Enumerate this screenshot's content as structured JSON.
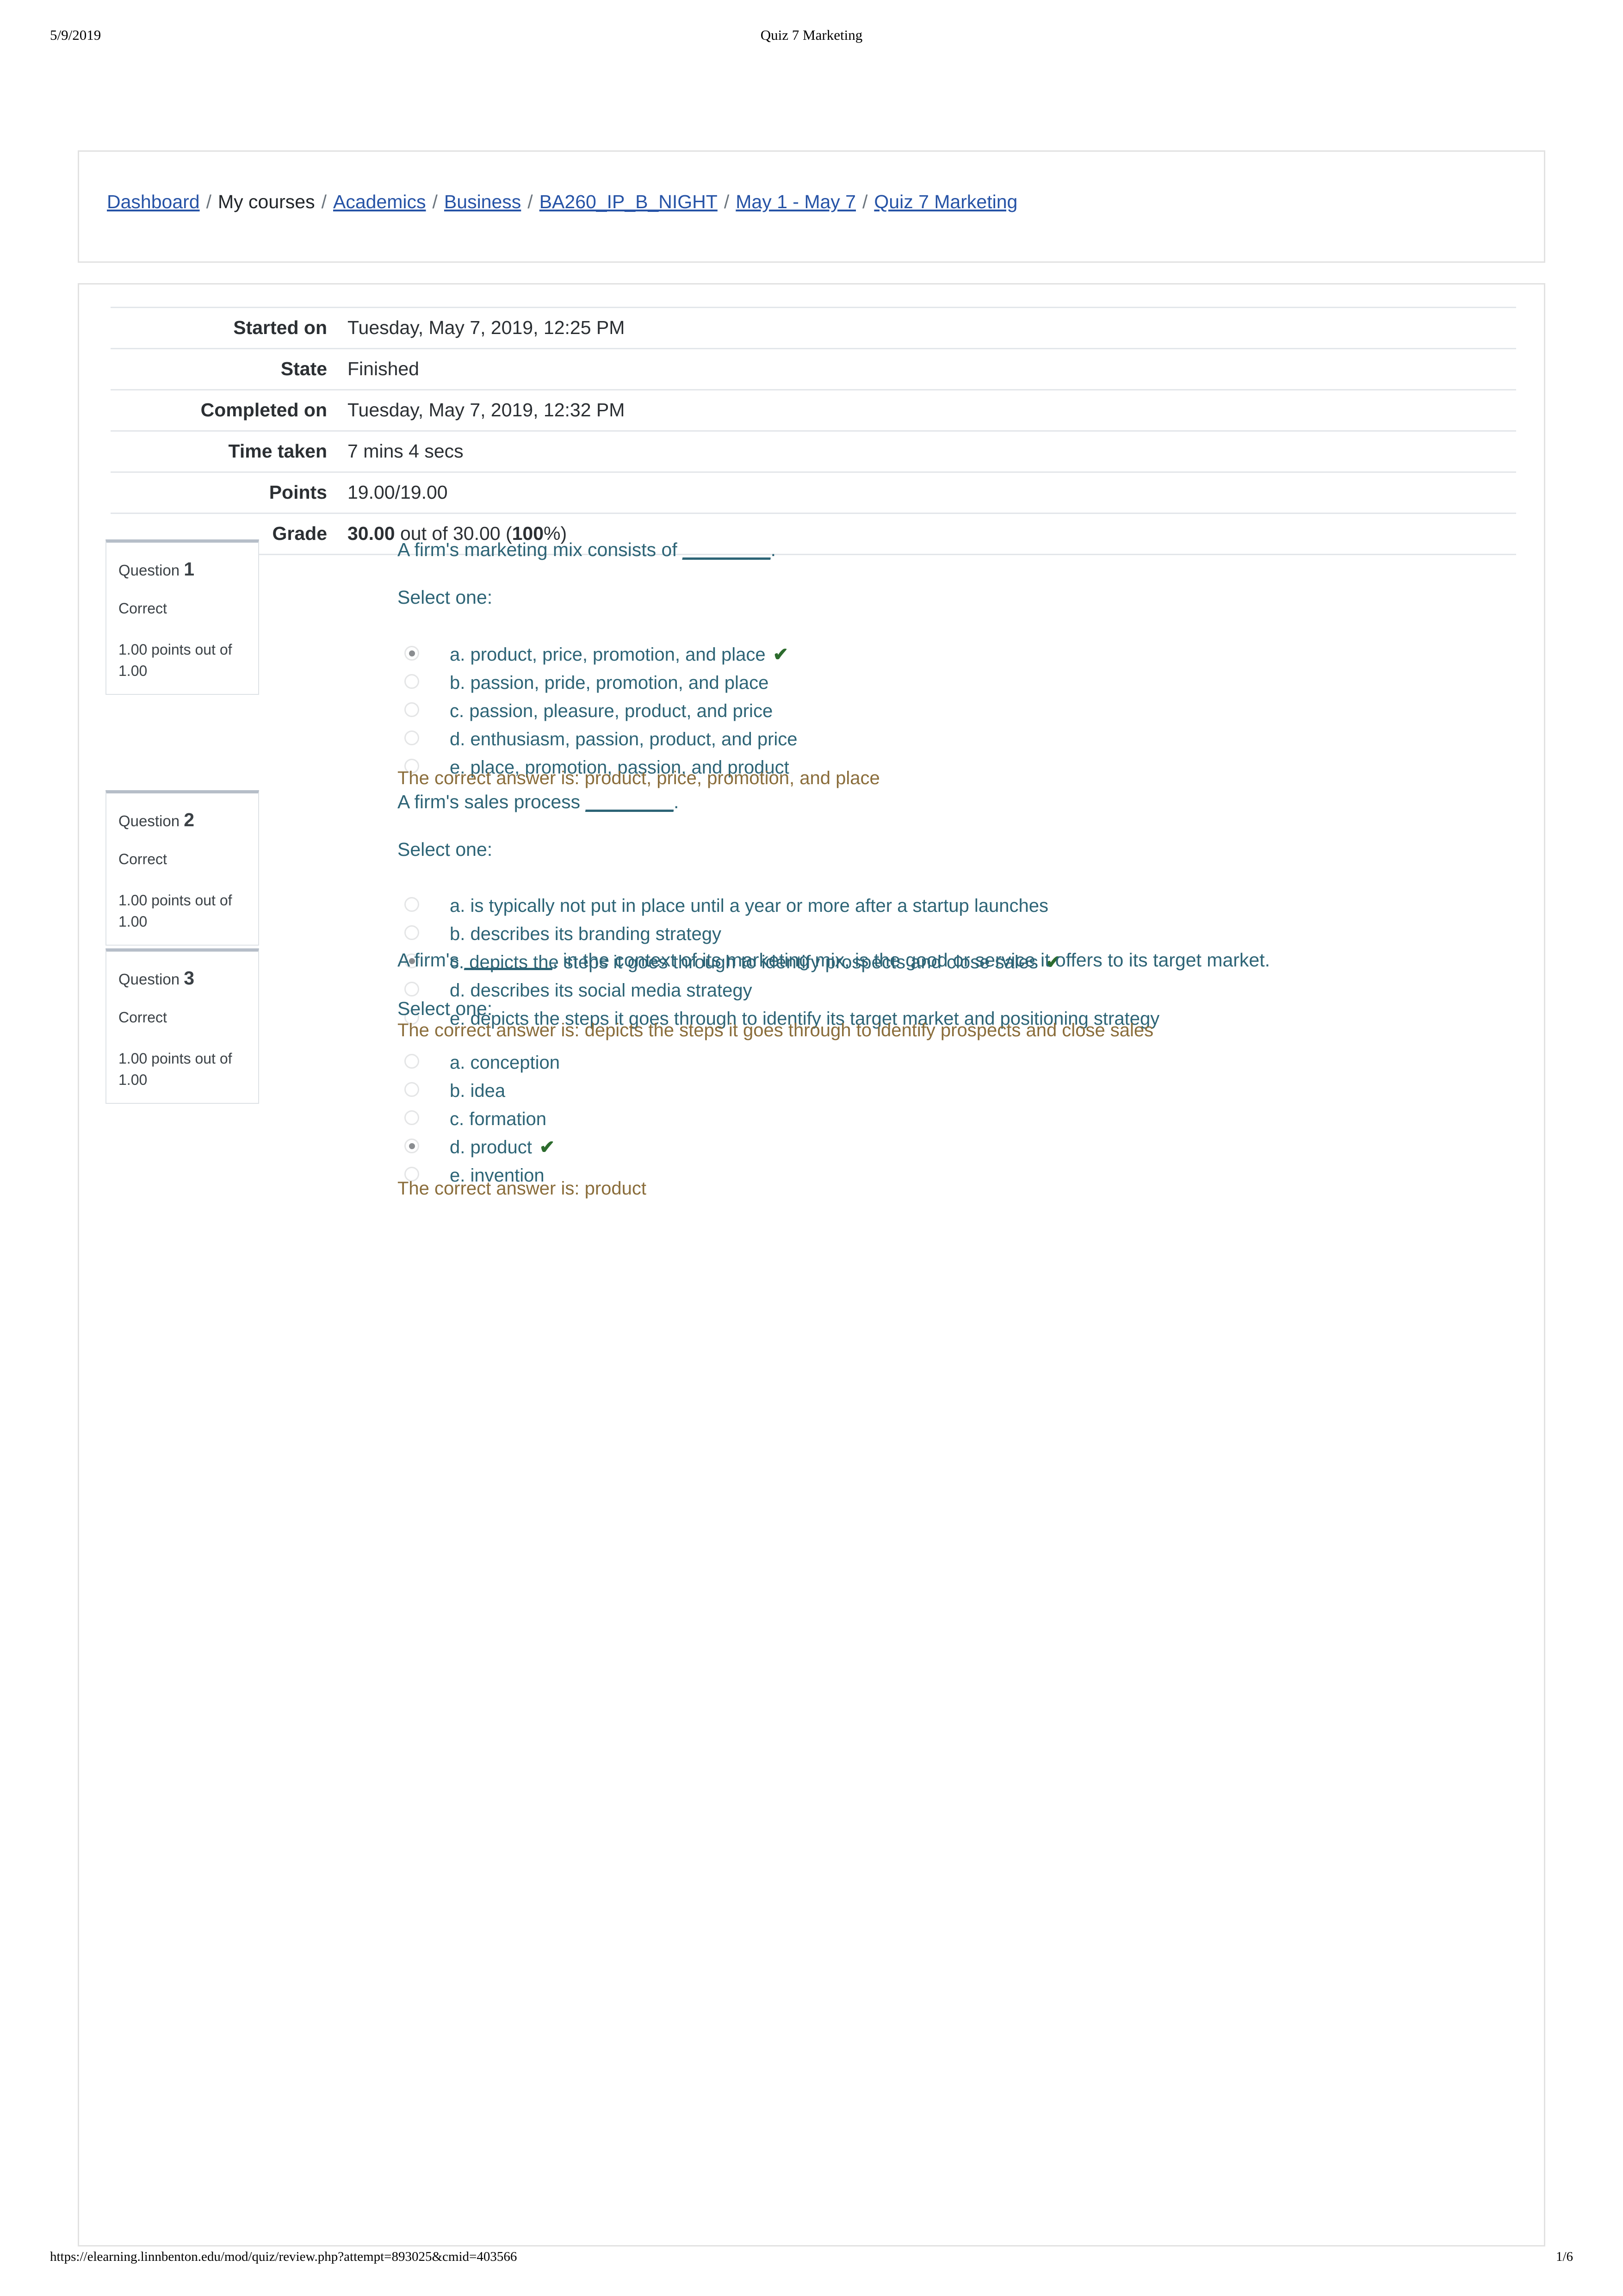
{
  "print": {
    "date": "5/9/2019",
    "doc_title": "Quiz 7 Marketing",
    "footer_url": "https://elearning.linnbenton.edu/mod/quiz/review.php?attempt=893025&cmid=403566",
    "page_number": "1/6"
  },
  "breadcrumb": {
    "separator": "/",
    "items": [
      {
        "label": "Dashboard",
        "link": true
      },
      {
        "label": "My courses",
        "link": false
      },
      {
        "label": "Academics",
        "link": true
      },
      {
        "label": "Business",
        "link": true
      },
      {
        "label": "BA260_IP_B_NIGHT",
        "link": true
      },
      {
        "label": "May 1 - May 7",
        "link": true
      },
      {
        "label": "Quiz 7 Marketing",
        "link": true
      }
    ]
  },
  "summary": {
    "rows": [
      {
        "key": "Started on",
        "value": "Tuesday, May 7, 2019, 12:25 PM"
      },
      {
        "key": "State",
        "value": "Finished"
      },
      {
        "key": "Completed on",
        "value": "Tuesday, May 7, 2019, 12:32 PM"
      },
      {
        "key": "Time taken",
        "value": "7 mins 4 secs"
      },
      {
        "key": "Points",
        "value": "19.00/19.00"
      },
      {
        "key": "Grade",
        "value": "30.00 out of 30.00 (100%)",
        "grade_score": "30.00",
        "grade_mid": " out of 30.00 (",
        "grade_pct": "100",
        "grade_end": "%)"
      }
    ]
  },
  "questions": [
    {
      "number": "1",
      "label": "Question",
      "state": "Correct",
      "grade": "1.00 points out of 1.00",
      "text_before": "A firm's marketing mix consists of ",
      "blank": "________",
      "text_after": ".",
      "prompt": "Select one:",
      "options": [
        {
          "key": "a.",
          "text": "product, price, promotion, and place",
          "selected": true,
          "correct": true
        },
        {
          "key": "b.",
          "text": "passion, pride, promotion, and place",
          "selected": false,
          "correct": false
        },
        {
          "key": "c.",
          "text": "passion, pleasure, product, and price",
          "selected": false,
          "correct": false
        },
        {
          "key": "d.",
          "text": "enthusiasm, passion, product, and price",
          "selected": false,
          "correct": false
        },
        {
          "key": "e.",
          "text": "place, promotion, passion, and product",
          "selected": false,
          "correct": false
        }
      ],
      "feedback": "The correct answer is: product, price, promotion, and place"
    },
    {
      "number": "2",
      "label": "Question",
      "state": "Correct",
      "grade": "1.00 points out of 1.00",
      "text_before": "A firm's sales process ",
      "blank": "________",
      "text_after": ".",
      "prompt": "Select one:",
      "options": [
        {
          "key": "a.",
          "text": "is typically not put in place until a year or more after a startup launches",
          "selected": false,
          "correct": false
        },
        {
          "key": "b.",
          "text": "describes its branding strategy",
          "selected": false,
          "correct": false
        },
        {
          "key": "c.",
          "text": "depicts the steps it goes through to identify prospects and close sales",
          "selected": true,
          "correct": true
        },
        {
          "key": "d.",
          "text": "describes its social media strategy",
          "selected": false,
          "correct": false
        },
        {
          "key": "e.",
          "text": "depicts the steps it goes through to identify its target market and positioning strategy",
          "selected": false,
          "correct": false
        }
      ],
      "feedback": "The correct answer is: depicts the steps it goes through to identify prospects and close sales"
    },
    {
      "number": "3",
      "label": "Question",
      "state": "Correct",
      "grade": "1.00 points out of 1.00",
      "text_before": "A firm's ",
      "blank": "________",
      "text_after": ", in the context of its marketing mix, is the good or service it offers to its target market.",
      "prompt": "Select one:",
      "options": [
        {
          "key": "a.",
          "text": "conception",
          "selected": false,
          "correct": false
        },
        {
          "key": "b.",
          "text": "idea",
          "selected": false,
          "correct": false
        },
        {
          "key": "c.",
          "text": "formation",
          "selected": false,
          "correct": false
        },
        {
          "key": "d.",
          "text": "product",
          "selected": true,
          "correct": true
        },
        {
          "key": "e.",
          "text": "invention",
          "selected": false,
          "correct": false
        }
      ],
      "feedback": "The correct answer is: product"
    }
  ],
  "icons": {
    "correct_tick": "✔"
  },
  "colors": {
    "link": "#2653a6",
    "question_text": "#2d6476",
    "feedback": "#8a6d3b",
    "tick_green": "#2c6b2d",
    "panel_border": "#e2e2e2",
    "qbox_top_border": "#b6bec8"
  }
}
